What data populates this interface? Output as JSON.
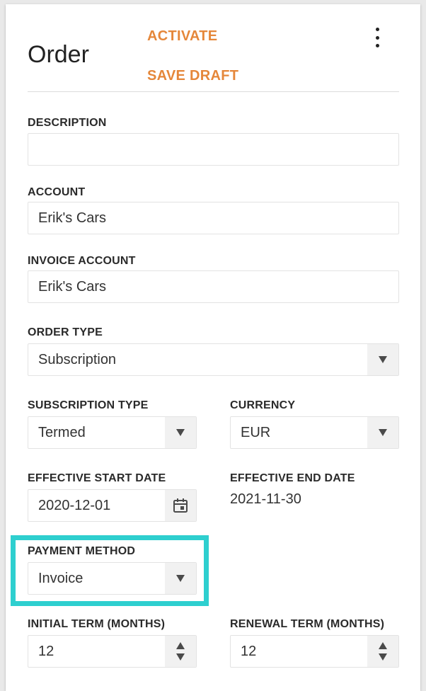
{
  "header": {
    "title": "Order",
    "activate_label": "ACTIVATE",
    "save_draft_label": "SAVE DRAFT",
    "more_icon": "kebab-menu-icon"
  },
  "fields": {
    "description": {
      "label": "DESCRIPTION",
      "value": ""
    },
    "account": {
      "label": "ACCOUNT",
      "value": "Erik's Cars"
    },
    "invoice_account": {
      "label": "INVOICE ACCOUNT",
      "value": "Erik's Cars"
    },
    "order_type": {
      "label": "ORDER TYPE",
      "value": "Subscription"
    },
    "subscription_type": {
      "label": "SUBSCRIPTION TYPE",
      "value": "Termed"
    },
    "currency": {
      "label": "CURRENCY",
      "value": "EUR"
    },
    "effective_start_date": {
      "label": "EFFECTIVE START DATE",
      "value": "2020-12-01",
      "icon": "calendar-icon"
    },
    "effective_end_date": {
      "label": "EFFECTIVE END DATE",
      "value": "2021-11-30"
    },
    "payment_method": {
      "label": "PAYMENT METHOD",
      "value": "Invoice"
    },
    "initial_term": {
      "label": "INITIAL TERM (MONTHS)",
      "value": "12"
    },
    "renewal_term": {
      "label": "RENEWAL TERM (MONTHS)",
      "value": "12"
    }
  },
  "colors": {
    "accent": "#e5873a",
    "highlight": "#2ecfcf"
  }
}
